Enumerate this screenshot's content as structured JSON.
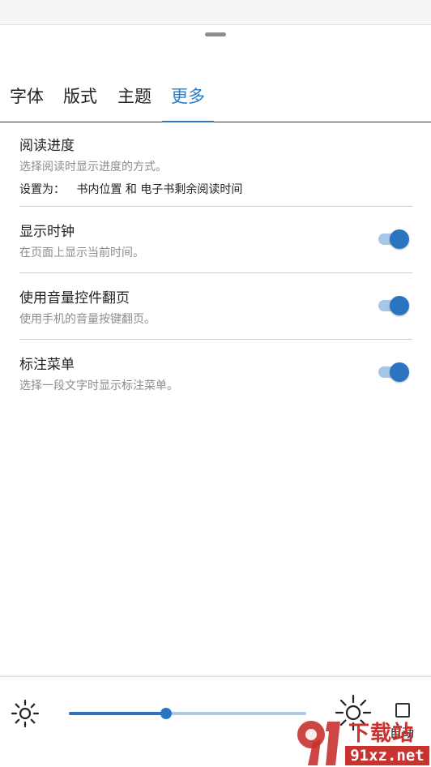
{
  "tabs": [
    {
      "label": "字体"
    },
    {
      "label": "版式"
    },
    {
      "label": "主题"
    },
    {
      "label": "更多",
      "active": true
    }
  ],
  "settings": {
    "reading_progress": {
      "title": "阅读进度",
      "description": "选择阅读时显示进度的方式。",
      "value_prefix": "设置为：",
      "value": "书内位置 和 电子书剩余阅读时间"
    },
    "show_clock": {
      "title": "显示时钟",
      "description": "在页面上显示当前时间。",
      "enabled": true
    },
    "volume_page_turn": {
      "title": "使用音量控件翻页",
      "description": "使用手机的音量按键翻页。",
      "enabled": true
    },
    "annotation_menu": {
      "title": "标注菜单",
      "description": "选择一段文字时显示标注菜单。",
      "enabled": true
    }
  },
  "brightness": {
    "level": 0.41,
    "auto_label": "自动",
    "auto_checked": false
  },
  "watermark": {
    "line1": "下载站",
    "line2": "91xz.net"
  },
  "colors": {
    "accent": "#2a7bc0",
    "toggle_on": "#2a74c2",
    "toggle_track": "#a6c7e6",
    "watermark": "#c8322f"
  }
}
